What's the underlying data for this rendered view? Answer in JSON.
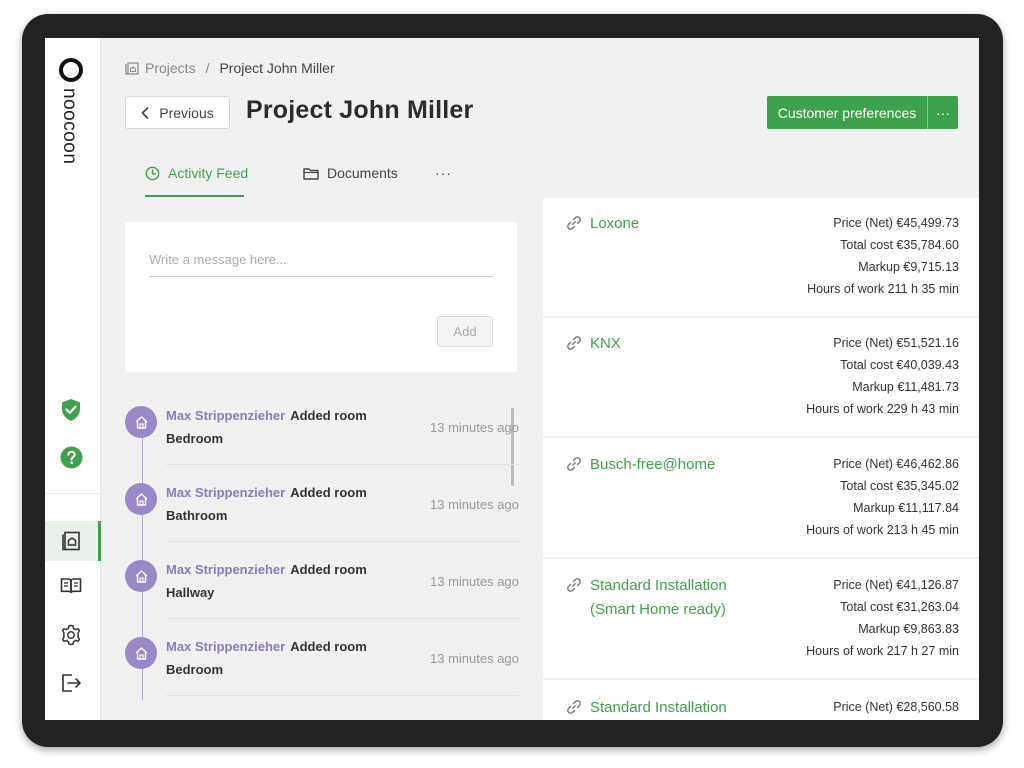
{
  "brand": {
    "name": "noocoon"
  },
  "breadcrumb": {
    "root": "Projects",
    "separator": "/",
    "current": "Project John Miller"
  },
  "header": {
    "previous_label": "Previous",
    "title": "Project John Miller",
    "customer_prefs_label": "Customer preferences",
    "more_label": "···"
  },
  "tabs": [
    {
      "label": "Activity Feed",
      "icon": "clock-icon",
      "active": true
    },
    {
      "label": "Documents",
      "icon": "folder-icon",
      "active": false
    },
    {
      "label": "···",
      "icon": "",
      "active": false
    }
  ],
  "composer": {
    "placeholder": "Write a message here...",
    "value": "",
    "add_label": "Add"
  },
  "feed": [
    {
      "user": "Max Strippenzieher",
      "action": "Added room",
      "room": "Bedroom",
      "time": "13 minutes ago"
    },
    {
      "user": "Max Strippenzieher",
      "action": "Added room",
      "room": "Bathroom",
      "time": "13 minutes ago"
    },
    {
      "user": "Max Strippenzieher",
      "action": "Added room",
      "room": "Hallway",
      "time": "13 minutes ago"
    },
    {
      "user": "Max Strippenzieher",
      "action": "Added room",
      "room": "Bedroom",
      "time": "13 minutes ago"
    }
  ],
  "packages": [
    {
      "name": "Loxone",
      "price": "Price (Net) €45,499.73",
      "total": "Total cost €35,784.60",
      "markup": "Markup €9,715.13",
      "hours": "Hours of work 211 h 35 min"
    },
    {
      "name": "KNX",
      "price": "Price (Net) €51,521.16",
      "total": "Total cost €40,039.43",
      "markup": "Markup €11,481.73",
      "hours": "Hours of work 229 h 43 min"
    },
    {
      "name": "Busch-free@home",
      "price": "Price (Net) €46,462.86",
      "total": "Total cost €35,345.02",
      "markup": "Markup €11,117.84",
      "hours": "Hours of work 213 h 45 min"
    },
    {
      "name": "Standard Installation (Smart Home ready)",
      "price": "Price (Net) €41,126.87",
      "total": "Total cost €31,263.04",
      "markup": "Markup €9,863.83",
      "hours": "Hours of work 217 h 27 min"
    },
    {
      "name": "Standard Installation",
      "price": "Price (Net) €28,560.58",
      "total": "",
      "markup": "",
      "hours": ""
    }
  ],
  "sidebar": {
    "items": [
      {
        "icon": "shield-check-icon",
        "active": false
      },
      {
        "icon": "help-icon",
        "active": false
      },
      {
        "icon": "projects-icon",
        "active": true
      },
      {
        "icon": "catalog-book-icon",
        "active": false
      },
      {
        "icon": "settings-gear-icon",
        "active": false
      },
      {
        "icon": "logout-icon",
        "active": false
      }
    ]
  },
  "colors": {
    "accent": "#3ea14b",
    "avatar": "#9b88c9",
    "user_name": "#8d79c1",
    "frame": "#222222",
    "background": "#f1f1f1"
  }
}
